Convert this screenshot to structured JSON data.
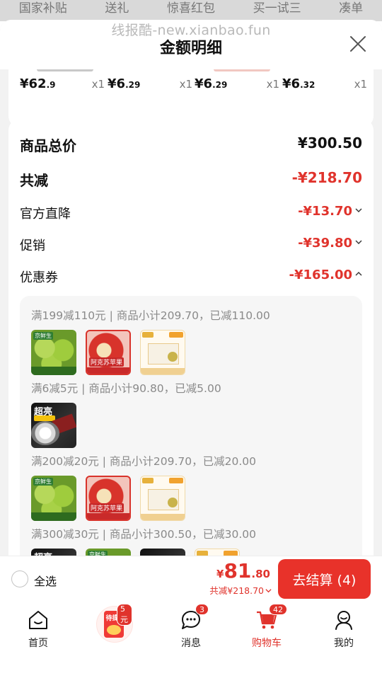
{
  "top_strip": {
    "items": [
      "国家补贴",
      "送礼",
      "惊喜红包",
      "买一试三",
      "凑单"
    ]
  },
  "header": {
    "watermark": "线报酷-new.xianbao.fun",
    "title": "金额明细"
  },
  "items_row": [
    {
      "price_int": "¥62",
      "price_dec": ".9",
      "qty": "x1"
    },
    {
      "price_int": "¥6",
      "price_dec": ".29",
      "qty": "x1"
    },
    {
      "price_int": "¥6",
      "price_dec": ".29",
      "qty": "x1"
    },
    {
      "price_int": "¥6",
      "price_dec": ".32",
      "qty": "x1"
    }
  ],
  "summary": {
    "total_label": "商品总价",
    "total_value": "¥300.50",
    "discount_label": "共减",
    "discount_value": "-¥218.70",
    "official_label": "官方直降",
    "official_value": "-¥13.70",
    "promo_label": "促销",
    "promo_value": "-¥39.80",
    "coupon_label": "优惠券",
    "coupon_value": "-¥165.00"
  },
  "coupons": [
    {
      "text": "满199减110元 | 商品小计209.70，已减110.00"
    },
    {
      "text": "满6减5元 | 商品小计90.80，已减5.00"
    },
    {
      "text": "满200减20元 | 商品小计209.70，已减20.00"
    },
    {
      "text": "满300减30元 | 商品小计300.50，已减30.00"
    }
  ],
  "product_images": {
    "green_apple_tag": "京鲜生",
    "red_apple_tag": "阿克苏苹果",
    "torch_tag": "超亮"
  },
  "bottom_bar": {
    "select_all": "全选",
    "price_symbol": "¥",
    "price_int": "81",
    "price_dec": ".80",
    "saved": "共减¥218.70",
    "checkout": "去结算 (4)"
  },
  "nav": {
    "home": "首页",
    "redpack_text": "待提现",
    "redpack_badge": "5元",
    "messages": "消息",
    "messages_badge": "3",
    "cart": "购物车",
    "cart_badge": "42",
    "mine": "我的"
  },
  "colors": {
    "accent_red": "#e0332c",
    "checkout_red": "#e8322a"
  }
}
